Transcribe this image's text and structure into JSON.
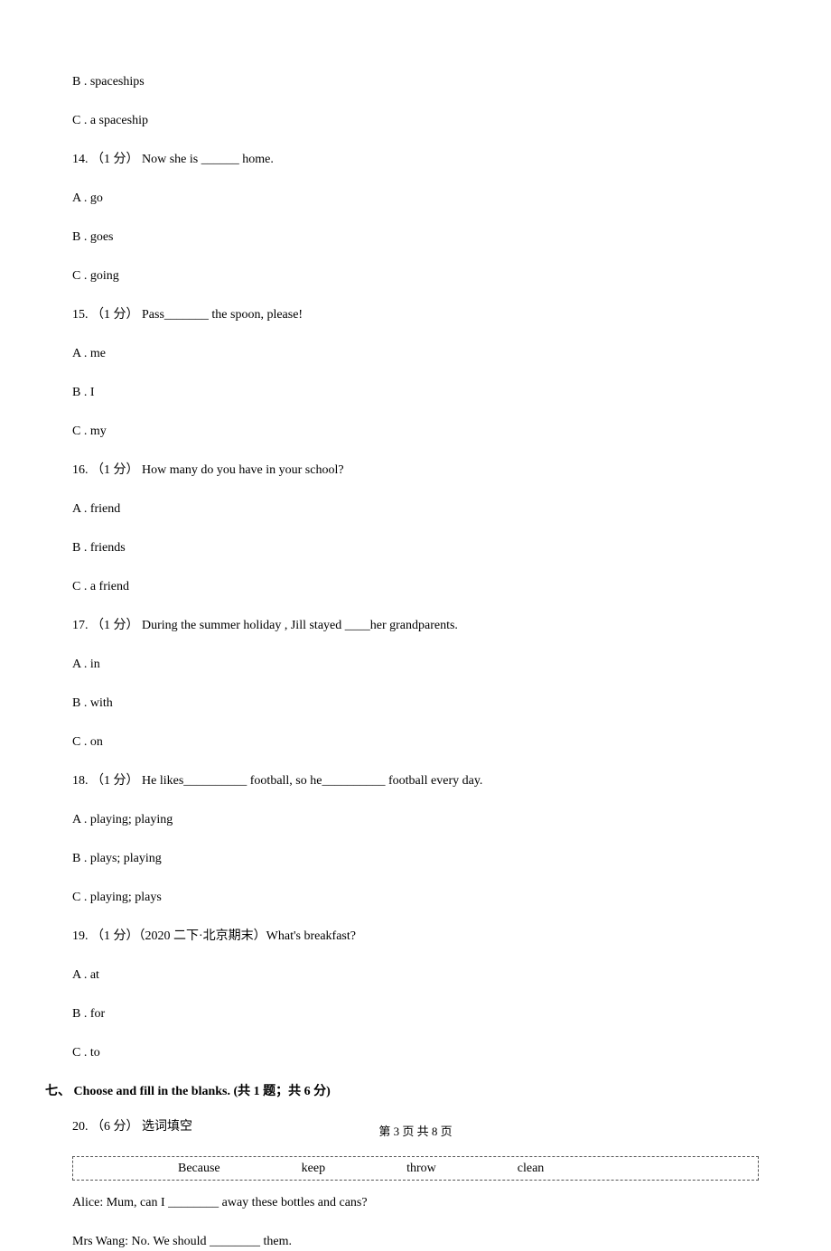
{
  "q13_opts": {
    "B": "B . spaceships",
    "C": "C . a spaceship"
  },
  "q14": {
    "text": "14. （1 分） Now she is ______ home.",
    "A": "A . go",
    "B": "B . goes",
    "C": "C . going"
  },
  "q15": {
    "text": "15. （1 分） Pass_______ the spoon, please!",
    "A": "A . me",
    "B": "B . I",
    "C": "C . my"
  },
  "q16": {
    "text": "16. （1 分） How many            do you have in your school?",
    "A": "A . friend",
    "B": "B . friends",
    "C": "C . a friend"
  },
  "q17": {
    "text": "17. （1 分） During the summer holiday , Jill stayed ____her grandparents.",
    "A": "A . in",
    "B": "B . with",
    "C": "C . on"
  },
  "q18": {
    "text": "18. （1 分） He likes__________ football, so he__________ football every day.",
    "A": "A . playing; playing",
    "B": "B . plays; playing",
    "C": "C . playing; plays"
  },
  "q19": {
    "text": "19. （1 分）（2020 二下·北京期末）What's           breakfast?",
    "A": "A . at",
    "B": "B . for",
    "C": "C . to"
  },
  "section7": "七、 Choose and fill in the blanks. (共 1 题；共 6 分)",
  "q20": {
    "text": "20. （6 分） 选词填空",
    "words": {
      "w1": "Because",
      "w2": "keep",
      "w3": "throw",
      "w4": "clean"
    },
    "line1": "Alice: Mum, can I ________ away these bottles and cans?",
    "line2": "Mrs Wang: No. We should ________ them."
  },
  "footer": "第 3 页 共 8 页"
}
